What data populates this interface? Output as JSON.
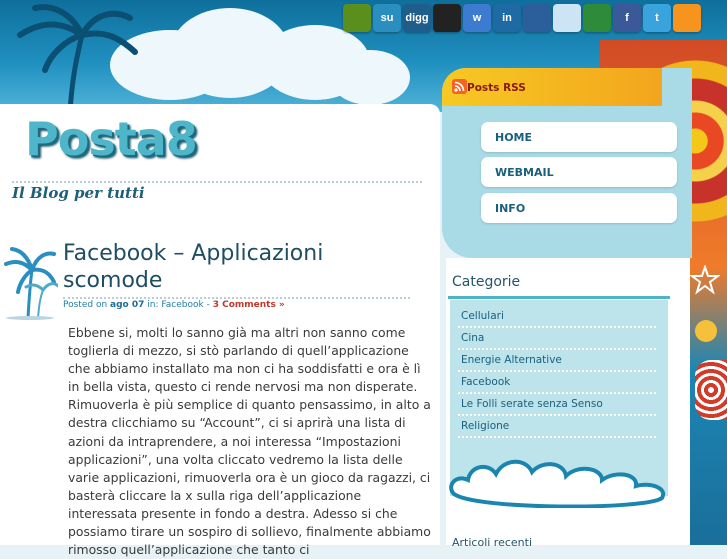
{
  "social": [
    {
      "name": "evernote-icon",
      "label": "",
      "bg": "#5a8f1e",
      "fg": "#ffffff"
    },
    {
      "name": "stumbleupon-icon",
      "label": "su",
      "bg": "#2a8fbf",
      "fg": "#ffffff"
    },
    {
      "name": "digg-icon",
      "label": "digg",
      "bg": "#1f5e8c",
      "fg": "#ffffff"
    },
    {
      "name": "delicious-icon",
      "label": "",
      "bg": "#222222",
      "fg": "#ffffff"
    },
    {
      "name": "windows-live-icon",
      "label": "w",
      "bg": "#3d7bd0",
      "fg": "#ffffff"
    },
    {
      "name": "linkedin-icon",
      "label": "in",
      "bg": "#1e6aa5",
      "fg": "#ffffff"
    },
    {
      "name": "myspace-icon",
      "label": "",
      "bg": "#2b5f9c",
      "fg": "#ffffff"
    },
    {
      "name": "reddit-icon",
      "label": "",
      "bg": "#cde4f4",
      "fg": "#333333"
    },
    {
      "name": "friendfeed-icon",
      "label": "",
      "bg": "#2e8b3a",
      "fg": "#ffffff"
    },
    {
      "name": "facebook-icon",
      "label": "f",
      "bg": "#3b5998",
      "fg": "#ffffff"
    },
    {
      "name": "twitter-icon",
      "label": "t",
      "bg": "#3aa3db",
      "fg": "#ffffff"
    },
    {
      "name": "rss-feed-icon",
      "label": "",
      "bg": "#f7941d",
      "fg": "#ffffff"
    }
  ],
  "site": {
    "logo": "Posta8",
    "tagline": "Il Blog per tutti"
  },
  "rss": {
    "label": "Posts RSS"
  },
  "nav": [
    {
      "label": "HOME"
    },
    {
      "label": "WEBMAIL"
    },
    {
      "label": "INFO"
    }
  ],
  "post": {
    "title": "Facebook – Applicazioni scomode",
    "meta_prefix": "Posted on",
    "date": "ago 07",
    "meta_in": "in:",
    "category": "Facebook",
    "separator": "-",
    "comments": "3 Comments »",
    "body": "Ebbene si, molti lo sanno già ma altri non sanno come toglierla di mezzo, si stò parlando di quell’applicazione che abbiamo installato ma non ci ha soddisfatti e ora è lì in bella vista, questo ci rende nervosi ma non disperate. Rimuoverla è più semplice di quanto pensassimo, in alto a destra clicchiamo su “Account”, ci si aprirà una lista di azioni da intraprendere, a noi interessa “Impostazioni applicazioni”, una volta cliccato vedremo la lista delle varie applicazioni, rimuoverla ora è un gioco da ragazzi, ci basterà cliccare la x sulla riga dell’applicazione interessata presente in fondo a destra. Adesso si che possiamo tirare un sospiro di sollievo, finalmente abbiamo rimosso quell’applicazione che tanto ci"
  },
  "sidebar": {
    "categories_title": "Categorie",
    "categories": [
      {
        "label": "Cellulari"
      },
      {
        "label": "Cina"
      },
      {
        "label": "Energie Alternative"
      },
      {
        "label": "Facebook"
      },
      {
        "label": "Le Folli serate senza Senso"
      },
      {
        "label": "Religione"
      }
    ],
    "cut_heading": "Articoli recenti"
  }
}
